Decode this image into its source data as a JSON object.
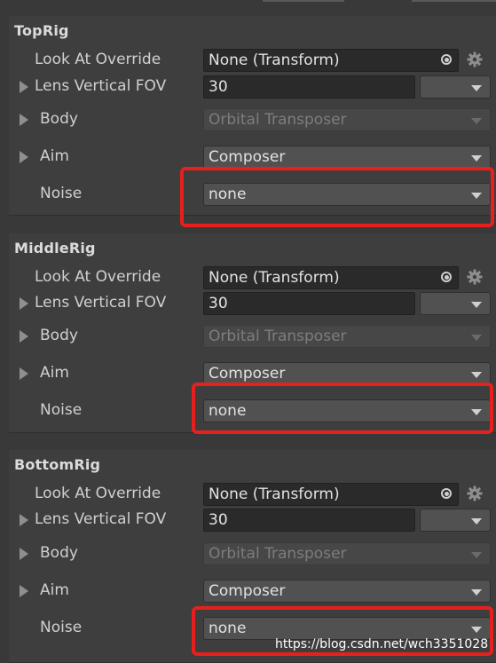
{
  "rigs": [
    {
      "title": "TopRig",
      "look_at_label": "Look At Override",
      "look_at_value": "None (Transform)",
      "fov_label": "Lens Vertical FOV",
      "fov_value": "30",
      "body_label": "Body",
      "body_value": "Orbital Transposer",
      "aim_label": "Aim",
      "aim_value": "Composer",
      "noise_label": "Noise",
      "noise_value": "none"
    },
    {
      "title": "MiddleRig",
      "look_at_label": "Look At Override",
      "look_at_value": "None (Transform)",
      "fov_label": "Lens Vertical FOV",
      "fov_value": "30",
      "body_label": "Body",
      "body_value": "Orbital Transposer",
      "aim_label": "Aim",
      "aim_value": "Composer",
      "noise_label": "Noise",
      "noise_value": "none"
    },
    {
      "title": "BottomRig",
      "look_at_label": "Look At Override",
      "look_at_value": "None (Transform)",
      "fov_label": "Lens Vertical FOV",
      "fov_value": "30",
      "body_label": "Body",
      "body_value": "Orbital Transposer",
      "aim_label": "Aim",
      "aim_value": "Composer",
      "noise_label": "Noise",
      "noise_value": "none"
    }
  ],
  "highlight_color": "#e8201d",
  "watermark": "https://blog.csdn.net/wch3351028"
}
